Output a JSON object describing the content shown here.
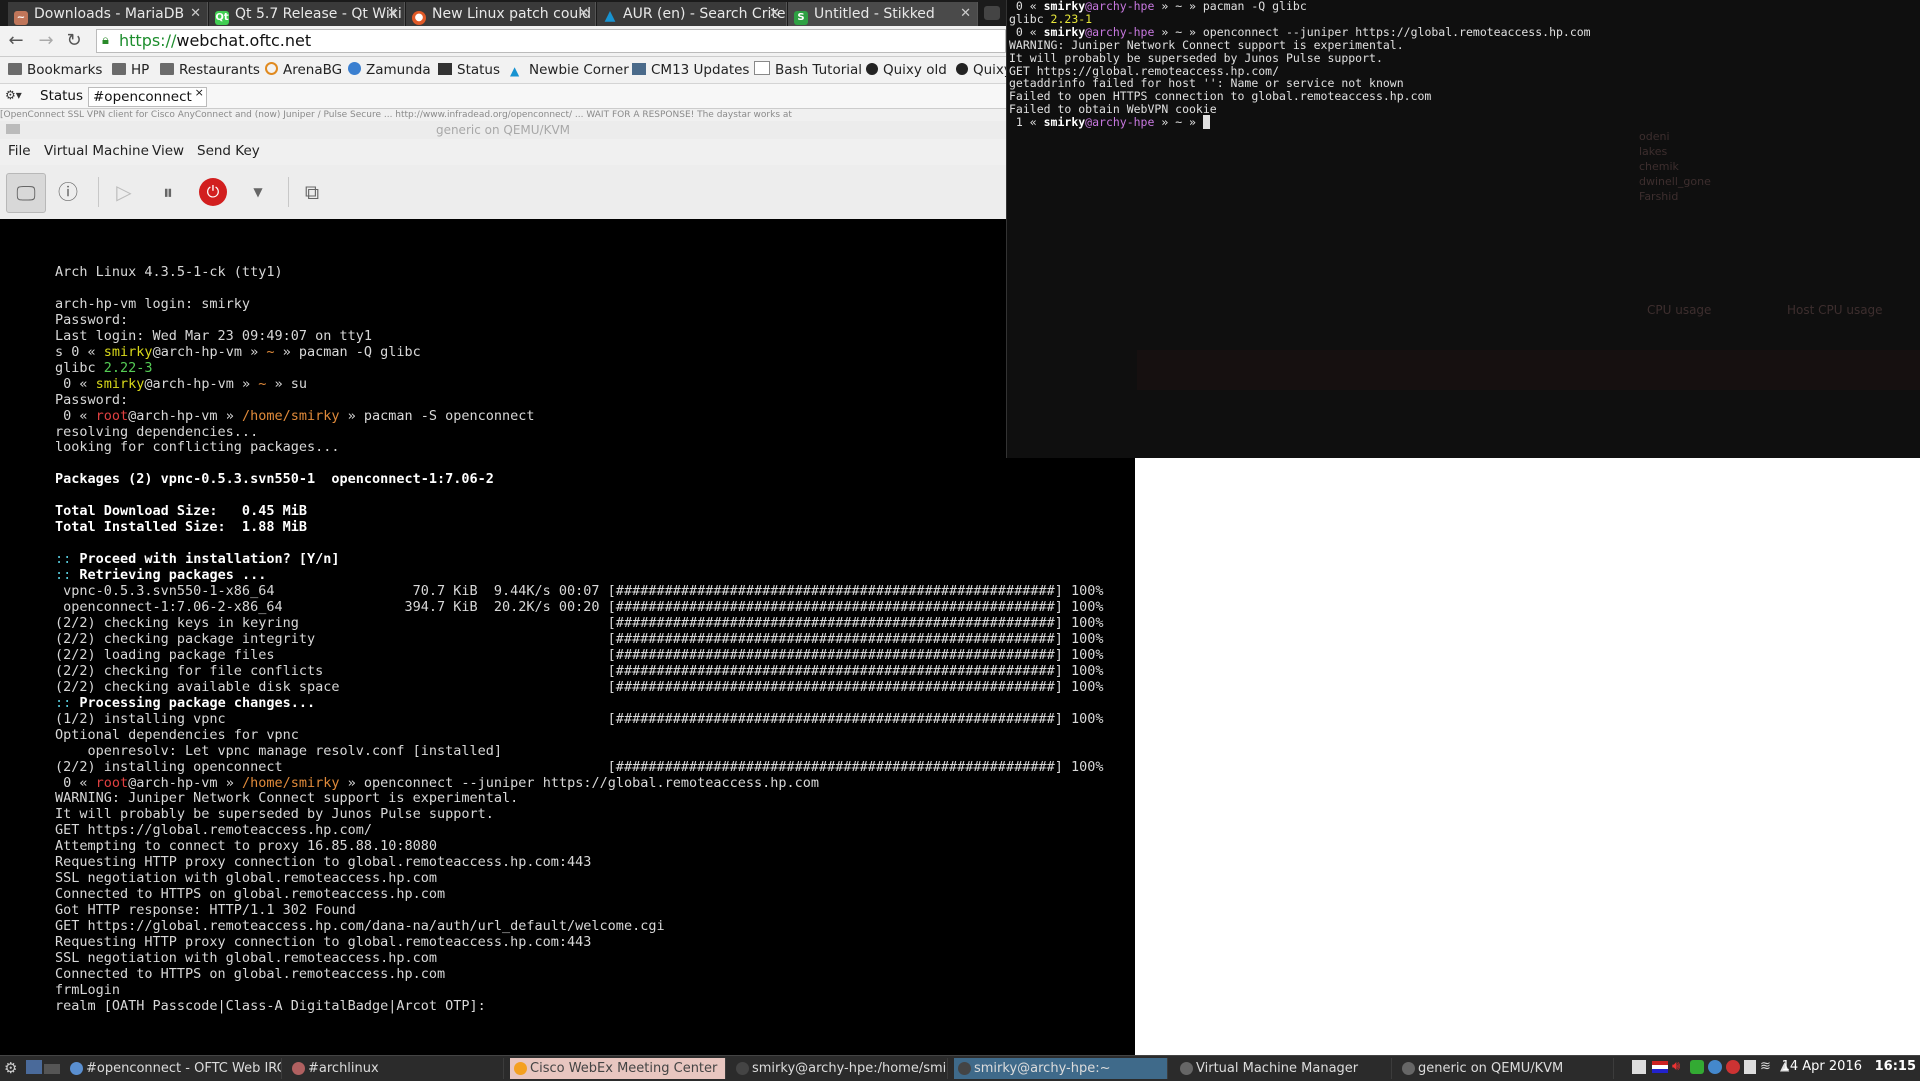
{
  "browser": {
    "tabs": [
      {
        "label": "Downloads - MariaDB",
        "icon": "mariadb-icon",
        "color": "#c0765a"
      },
      {
        "label": "Qt 5.7 Release - Qt Wiki",
        "icon": "qt-icon",
        "color": "#41cd52"
      },
      {
        "label": "New Linux patch could",
        "icon": "news-icon",
        "color": "#e05a28"
      },
      {
        "label": "AUR (en) - Search Criter",
        "icon": "arch-icon",
        "color": "#1793d1"
      },
      {
        "label": "Untitled - Stikked",
        "icon": "stikked-icon",
        "color": "#2ea043"
      }
    ],
    "url_scheme": "https://",
    "url_host": "webchat.oftc.net",
    "bookmarks": [
      {
        "label": "Bookmarks",
        "icon": "folder-icon"
      },
      {
        "label": "HP",
        "icon": "folder-icon"
      },
      {
        "label": "Restaurants",
        "icon": "folder-icon"
      },
      {
        "label": "ArenaBG",
        "icon": "arenabg-icon"
      },
      {
        "label": "Zamunda",
        "icon": "zamunda-icon"
      },
      {
        "label": "Status",
        "icon": "status-icon"
      },
      {
        "label": "Newbie Corner",
        "icon": "arch-icon"
      },
      {
        "label": "CM13 Updates",
        "icon": "cm-icon"
      },
      {
        "label": "Bash Tutorial",
        "icon": "page-icon"
      },
      {
        "label": "Quixy old",
        "icon": "quixy-icon"
      },
      {
        "label": "Quixy",
        "icon": "quixy-icon"
      }
    ]
  },
  "irc": {
    "tabs": [
      "Status",
      "#openconnect"
    ],
    "close": "×",
    "topic": "[OpenConnect SSL VPN client for Cisco AnyConnect and (now) Juniper / Pulse Secure ... http://www.infradead.org/openconnect/ ... WAIT FOR A RESPONSE! The daystar works at"
  },
  "vm": {
    "title": "generic on QEMU/KVM",
    "menu": [
      "File",
      "Virtual Machine",
      "View",
      "Send Key"
    ]
  },
  "console_lines": [
    "Arch Linux 4.3.5-1-ck (tty1)",
    "",
    "arch-hp-vm login: smirky",
    "Password:",
    "Last login: Wed Mar 23 09:49:07 on tty1",
    "s 0 « smirky@arch-hp-vm » ~ » pacman -Q glibc",
    "glibc 2.22-3",
    " 0 « smirky@arch-hp-vm » ~ » su",
    "Password:",
    " 0 « root@arch-hp-vm » /home/smirky » pacman -S openconnect",
    "resolving dependencies...",
    "looking for conflicting packages...",
    "",
    "Packages (2) vpnc-0.5.3.svn550-1  openconnect-1:7.06-2",
    "",
    "Total Download Size:   0.45 MiB",
    "Total Installed Size:  1.88 MiB",
    "",
    ":: Proceed with installation? [Y/n]",
    ":: Retrieving packages ...",
    " vpnc-0.5.3.svn550-1-x86_64                 70.7 KiB  9.44K/s 00:07 [######################################################] 100%",
    " openconnect-1:7.06-2-x86_64               394.7 KiB  20.2K/s 00:20 [######################################################] 100%",
    "(2/2) checking keys in keyring                                      [######################################################] 100%",
    "(2/2) checking package integrity                                    [######################################################] 100%",
    "(2/2) loading package files                                         [######################################################] 100%",
    "(2/2) checking for file conflicts                                   [######################################################] 100%",
    "(2/2) checking available disk space                                 [######################################################] 100%",
    ":: Processing package changes...",
    "(1/2) installing vpnc                                               [######################################################] 100%",
    "Optional dependencies for vpnc",
    "    openresolv: Let vpnc manage resolv.conf [installed]",
    "(2/2) installing openconnect                                        [######################################################] 100%",
    " 0 « root@arch-hp-vm » /home/smirky » openconnect --juniper https://global.remoteaccess.hp.com",
    "WARNING: Juniper Network Connect support is experimental.",
    "It will probably be superseded by Junos Pulse support.",
    "GET https://global.remoteaccess.hp.com/",
    "Attempting to connect to proxy 16.85.88.10:8080",
    "Requesting HTTP proxy connection to global.remoteaccess.hp.com:443",
    "SSL negotiation with global.remoteaccess.hp.com",
    "Connected to HTTPS on global.remoteaccess.hp.com",
    "Got HTTP response: HTTP/1.1 302 Found",
    "GET https://global.remoteaccess.hp.com/dana-na/auth/url_default/welcome.cgi",
    "Requesting HTTP proxy connection to global.remoteaccess.hp.com:443",
    "SSL negotiation with global.remoteaccess.hp.com",
    "Connected to HTTPS on global.remoteaccess.hp.com",
    "frmLogin",
    "realm [OATH Passcode|Class-A DigitalBadge|Arcot OTP]:"
  ],
  "terminal_lines": [
    " 0 « smirky@archy-hpe » ~ » pacman -Q glibc",
    "glibc 2.23-1",
    " 0 « smirky@archy-hpe » ~ » openconnect --juniper https://global.remoteaccess.hp.com",
    "WARNING: Juniper Network Connect support is experimental.",
    "It will probably be superseded by Junos Pulse support.",
    "GET https://global.remoteaccess.hp.com/",
    "getaddrinfo failed for host '': Name or service not known",
    "Failed to open HTTPS connection to global.remoteaccess.hp.com",
    "Failed to obtain WebVPN cookie",
    " 1 « smirky@archy-hpe » ~ » "
  ],
  "background_ghost": [
    "CPU usage",
    "Host CPU usage",
    "odeni",
    "lakes",
    "chemik",
    "dwinell_gone",
    "Farshid"
  ],
  "taskbar": {
    "items": [
      {
        "label": "#openconnect - OFTC Web IRC",
        "color": "#5a8fd0"
      },
      {
        "label": "#archlinux",
        "color": "#b06060"
      },
      {
        "label": "Cisco WebEx Meeting Center",
        "color": "#f4a020"
      },
      {
        "label": "smirky@archy-hpe:/home/smirky",
        "color": "#444444"
      },
      {
        "label": "smirky@archy-hpe:~",
        "color": "#444444"
      },
      {
        "label": "Virtual Machine Manager",
        "color": "#666666"
      },
      {
        "label": "generic on QEMU/KVM",
        "color": "#666666"
      }
    ],
    "date": "14 Apr 2016",
    "time": "16:15"
  }
}
